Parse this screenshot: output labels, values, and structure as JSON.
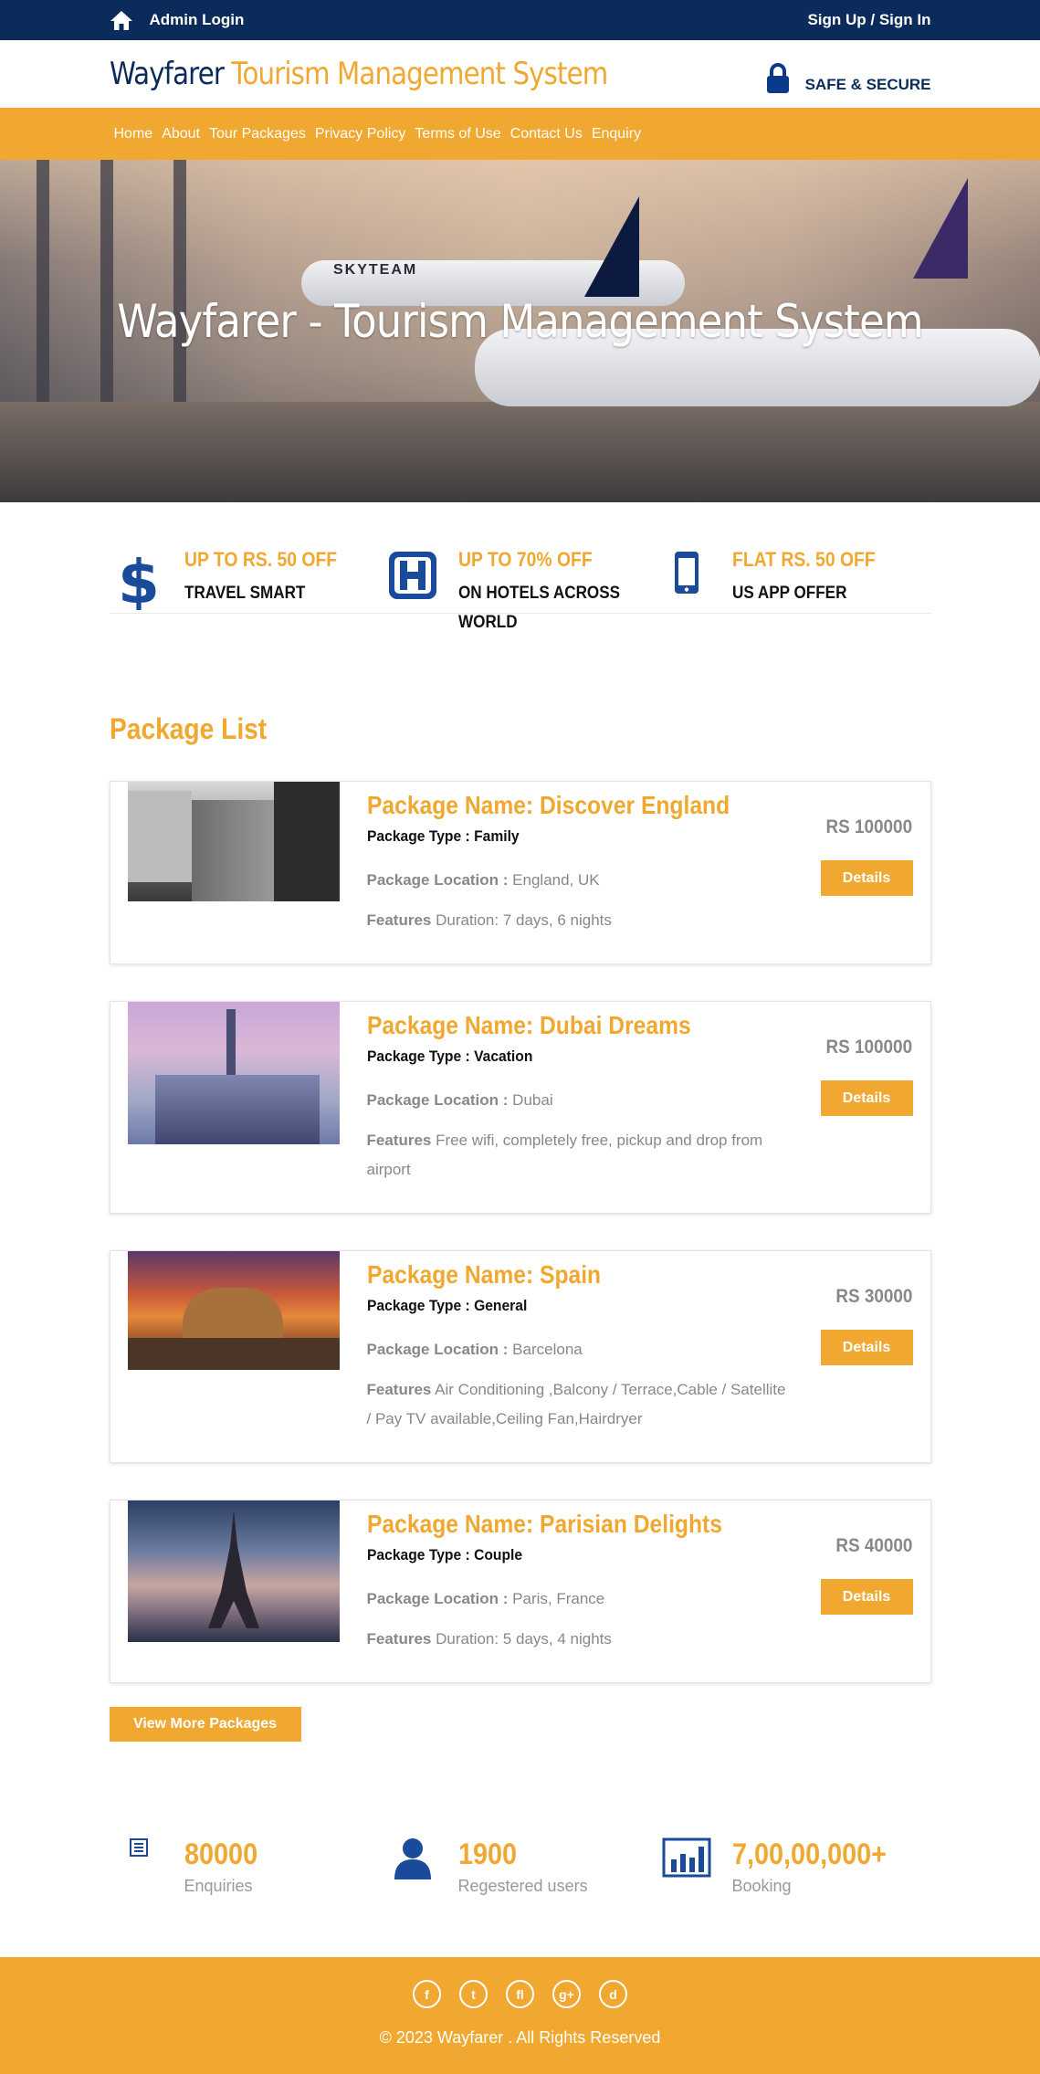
{
  "topbar": {
    "admin_login": "Admin Login",
    "sign": "Sign Up / Sign In"
  },
  "header": {
    "logo_part1": "Wayfarer",
    "logo_part2": "Tourism Management System",
    "secure": "SAFE & SECURE"
  },
  "nav": [
    "Home",
    "About",
    "Tour Packages",
    "Privacy Policy",
    "Terms of Use",
    "Contact Us",
    "Enquiry"
  ],
  "banner": {
    "title": "Wayfarer - Tourism Management System",
    "plane_text": "SKYTEAM"
  },
  "offers": [
    {
      "title": "UP TO RS. 50 OFF",
      "sub": "TRAVEL SMART",
      "icon": "dollar-icon"
    },
    {
      "title": "UP TO 70% OFF",
      "sub": "ON HOTELS ACROSS WORLD",
      "icon": "hotel-icon"
    },
    {
      "title": "FLAT RS. 50 OFF",
      "sub": "US APP OFFER",
      "icon": "mobile-icon"
    }
  ],
  "package_list_title": "Package List",
  "packages": [
    {
      "name": "Package Name: Discover England",
      "type": "Package Type : Family",
      "location_label": "Package Location :",
      "location": "England, UK",
      "features_label": "Features",
      "features": "Duration: 7 days, 6 nights",
      "price": "RS 100000",
      "button": "Details"
    },
    {
      "name": "Package Name: Dubai Dreams",
      "type": "Package Type : Vacation",
      "location_label": "Package Location :",
      "location": "Dubai",
      "features_label": "Features",
      "features": "Free wifi, completely free, pickup and drop from airport",
      "price": "RS 100000",
      "button": "Details"
    },
    {
      "name": "Package Name: Spain",
      "type": "Package Type : General",
      "location_label": "Package Location :",
      "location": "Barcelona",
      "features_label": "Features",
      "features": "Air Conditioning ,Balcony / Terrace,Cable / Satellite / Pay TV available,Ceiling Fan,Hairdryer",
      "price": "RS 30000",
      "button": "Details"
    },
    {
      "name": "Package Name: Parisian Delights",
      "type": "Package Type : Couple",
      "location_label": "Package Location :",
      "location": "Paris, France",
      "features_label": "Features",
      "features": "Duration: 5 days, 4 nights",
      "price": "RS 40000",
      "button": "Details"
    }
  ],
  "view_more": "View More Packages",
  "stats": [
    {
      "num": "80000",
      "label": "Enquiries",
      "icon": "list-icon"
    },
    {
      "num": "1900",
      "label": "Regestered users",
      "icon": "user-icon"
    },
    {
      "num": "7,00,00,000+",
      "label": "Booking",
      "icon": "bar-chart-icon"
    }
  ],
  "footer": {
    "copyright": "© 2023 Wayfarer . All Rights Reserved",
    "social": [
      "f",
      "t",
      "fl",
      "g+",
      "d"
    ]
  },
  "colors": {
    "navy": "#0b2b5a",
    "accent": "#f0a830",
    "icon_blue": "#1a4a9a"
  }
}
